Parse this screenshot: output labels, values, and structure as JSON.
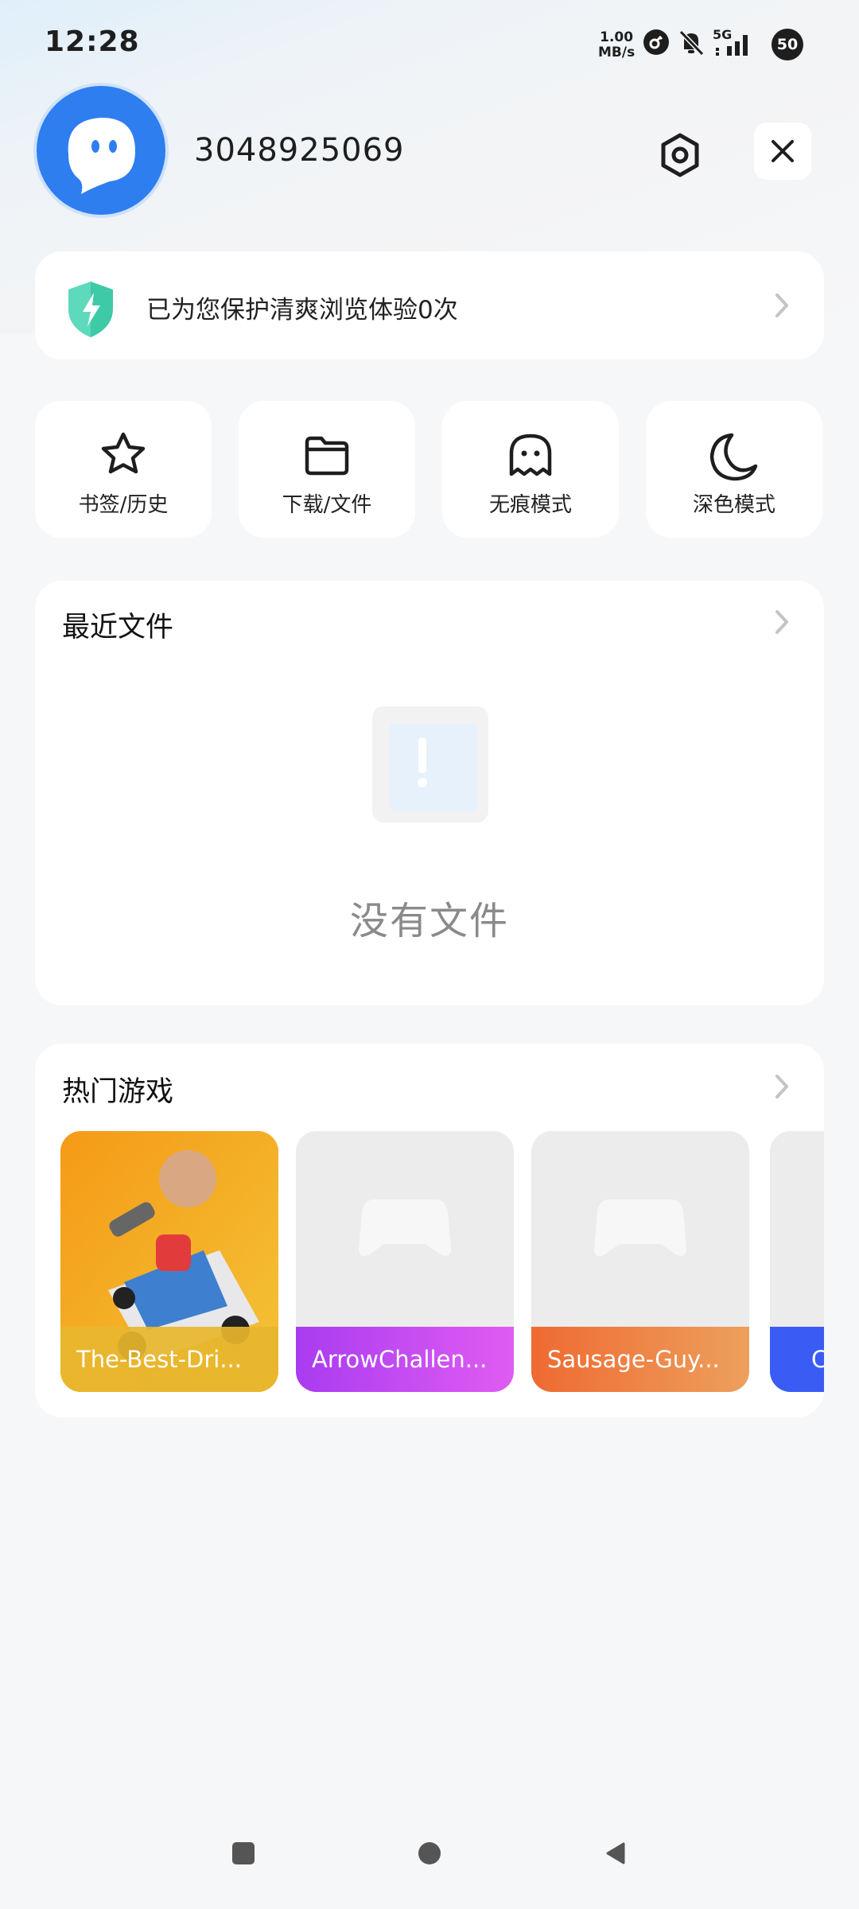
{
  "status": {
    "time": "12:28",
    "speed_value": "1.00",
    "speed_unit": "MB/s",
    "network": "5G",
    "battery": "50"
  },
  "header": {
    "username": "3048925069"
  },
  "protection": {
    "text": "已为您保护清爽浏览体验0次"
  },
  "features": [
    {
      "label": "书签/历史",
      "icon": "star-icon"
    },
    {
      "label": "下载/文件",
      "icon": "folder-icon"
    },
    {
      "label": "无痕模式",
      "icon": "ghost-icon"
    },
    {
      "label": "深色模式",
      "icon": "moon-icon"
    }
  ],
  "recent_files": {
    "title": "最近文件",
    "empty_text": "没有文件"
  },
  "hot_games": {
    "title": "热门游戏",
    "items": [
      {
        "name": "The-Best-Dri...",
        "color": "#e7b62e"
      },
      {
        "name": "ArrowChallen...",
        "color": "#c44cf0"
      },
      {
        "name": "Sausage-Guy...",
        "color": "#ef7a3f"
      },
      {
        "name": "C",
        "color": "#3a5cf5"
      }
    ]
  },
  "colors": {
    "accent": "#2f7ef0",
    "shield": "#3ec9a7"
  }
}
